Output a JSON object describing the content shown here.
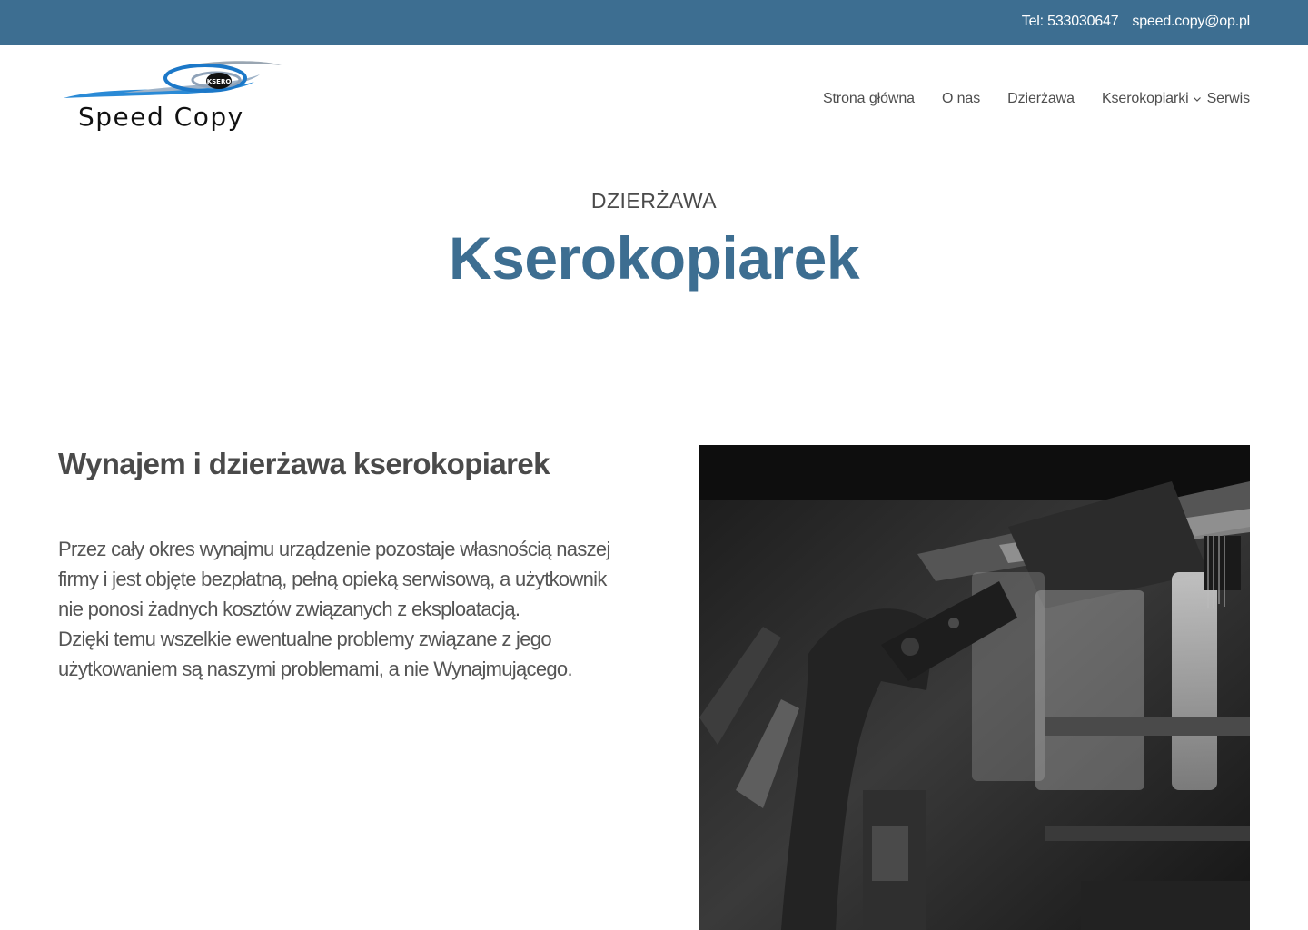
{
  "topbar": {
    "phone": "Tel: 533030647",
    "email": "speed.copy@op.pl",
    "background": "#3d6e91"
  },
  "logo": {
    "badge_text": "KSERO",
    "brand_text": "Speed Copy"
  },
  "nav": {
    "items": [
      {
        "label": "Strona główna"
      },
      {
        "label": "O nas"
      },
      {
        "label": "Dzierżawa"
      },
      {
        "label": "Kserokopiarki",
        "icon": "chevron-down-icon"
      },
      {
        "label": "Serwis"
      }
    ]
  },
  "hero": {
    "subtitle": "DZIERŻAWA",
    "title": "Kserokopiarek",
    "accent_color": "#3d6e91"
  },
  "section": {
    "heading": "Wynajem i dzierżawa kserokopiarek",
    "paragraph1": "Przez cały okres wynajmu urządzenie pozostaje własnością naszej firmy i jest objęte bezpłatną, pełną opieką serwisową, a użytkownik nie ponosi żadnych kosztów związanych z eksploatacją.",
    "paragraph2": "Dzięki temu wszelkie ewentualne problemy związane z jego użytkowaniem są naszymi problemami, a nie Wynajmującego."
  }
}
